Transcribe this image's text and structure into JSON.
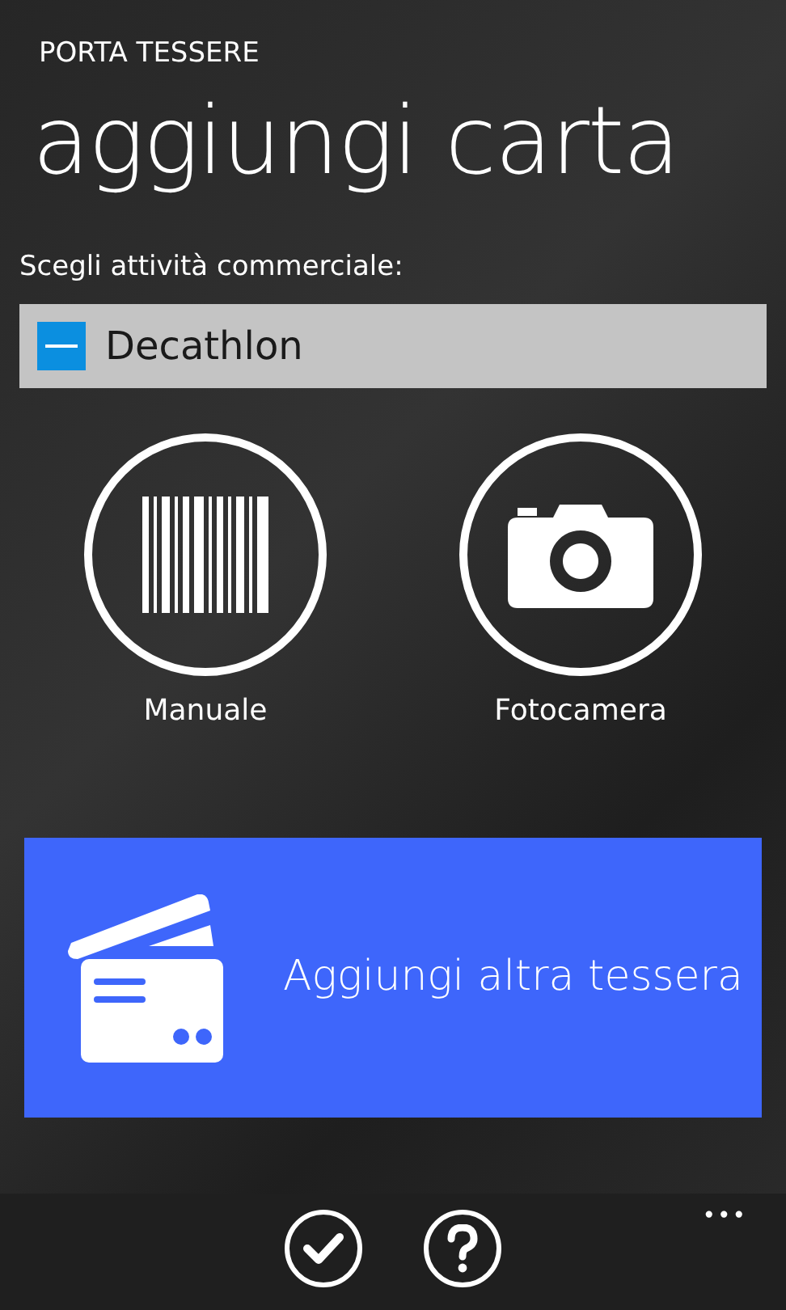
{
  "app_title": "PORTA TESSERE",
  "page_title": "aggiungi carta",
  "store_label": "Scegli attività commerciale:",
  "store_picker": {
    "value": "Decathlon"
  },
  "entry_options": [
    {
      "kind": "barcode",
      "label": "Manuale"
    },
    {
      "kind": "camera",
      "label": "Fotocamera"
    }
  ],
  "add_tile": {
    "label": "Aggiungi altra tessera"
  },
  "app_bar": {
    "buttons": [
      {
        "kind": "confirm"
      },
      {
        "kind": "help"
      }
    ],
    "more": "•••"
  }
}
